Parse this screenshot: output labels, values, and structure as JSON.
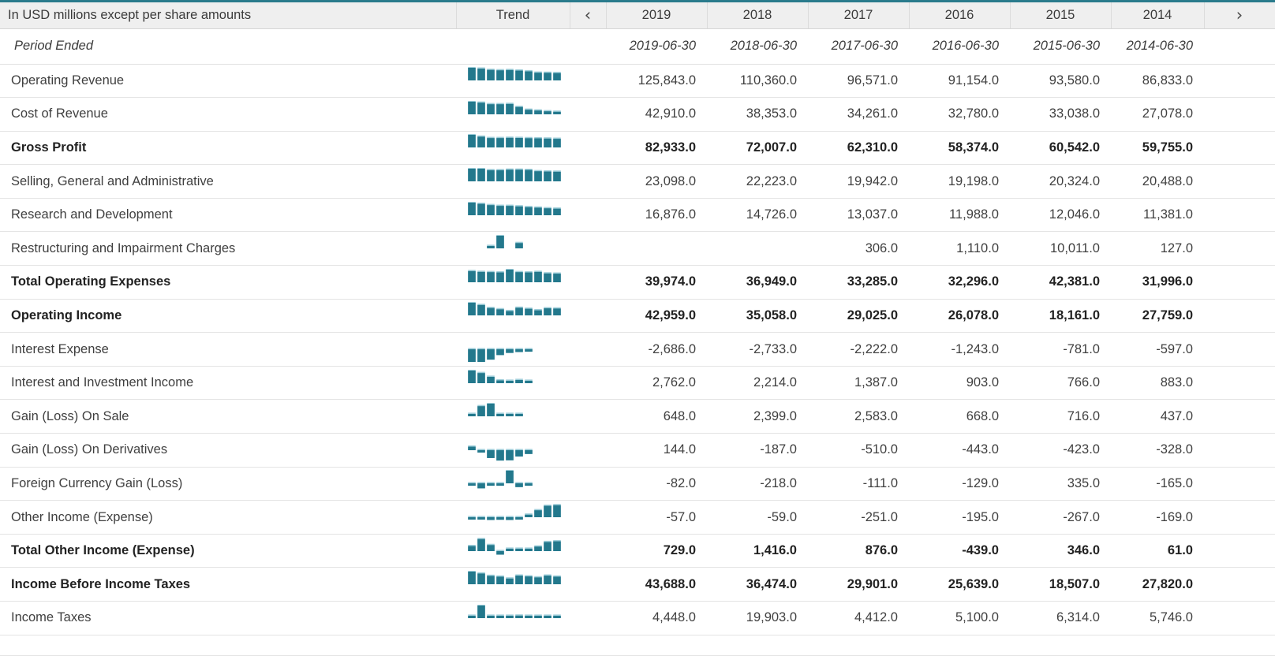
{
  "header": {
    "label_column": "In USD millions except per share amounts",
    "trend_column": "Trend",
    "prev_icon": "‹",
    "next_icon": "›",
    "years": [
      "2019",
      "2018",
      "2017",
      "2016",
      "2015",
      "2014"
    ]
  },
  "period": {
    "label": "Period Ended",
    "dates": [
      "2019-06-30",
      "2018-06-30",
      "2017-06-30",
      "2016-06-30",
      "2015-06-30",
      "2014-06-30"
    ]
  },
  "colors": {
    "accent_top_border": "#2a7b8c",
    "sparkline_bar": "#23788c",
    "sparkline_bar_light": "#9cccd8",
    "header_bg": "#efefef",
    "row_border": "#e4e4e4",
    "text": "#3f3f3f"
  },
  "chart_data": {
    "type": "table",
    "title": "Income Statement",
    "units": "In USD millions except per share amounts",
    "categories": [
      "2019",
      "2018",
      "2017",
      "2016",
      "2015",
      "2014"
    ],
    "period_ends": [
      "2019-06-30",
      "2018-06-30",
      "2017-06-30",
      "2016-06-30",
      "2015-06-30",
      "2014-06-30"
    ],
    "series": [
      {
        "name": "Operating Revenue",
        "values": [
          125843.0,
          110360.0,
          96571.0,
          91154.0,
          93580.0,
          86833.0
        ]
      },
      {
        "name": "Cost of Revenue",
        "values": [
          42910.0,
          38353.0,
          34261.0,
          32780.0,
          33038.0,
          27078.0
        ]
      },
      {
        "name": "Gross Profit",
        "values": [
          82933.0,
          72007.0,
          62310.0,
          58374.0,
          60542.0,
          59755.0
        ]
      },
      {
        "name": "Selling, General and Administrative",
        "values": [
          23098.0,
          22223.0,
          19942.0,
          19198.0,
          20324.0,
          20488.0
        ]
      },
      {
        "name": "Research and Development",
        "values": [
          16876.0,
          14726.0,
          13037.0,
          11988.0,
          12046.0,
          11381.0
        ]
      },
      {
        "name": "Restructuring and Impairment Charges",
        "values": [
          null,
          null,
          306.0,
          1110.0,
          10011.0,
          127.0
        ]
      },
      {
        "name": "Total Operating Expenses",
        "values": [
          39974.0,
          36949.0,
          33285.0,
          32296.0,
          42381.0,
          31996.0
        ]
      },
      {
        "name": "Operating Income",
        "values": [
          42959.0,
          35058.0,
          29025.0,
          26078.0,
          18161.0,
          27759.0
        ]
      },
      {
        "name": "Interest Expense",
        "values": [
          -2686.0,
          -2733.0,
          -2222.0,
          -1243.0,
          -781.0,
          -597.0
        ]
      },
      {
        "name": "Interest and Investment Income",
        "values": [
          2762.0,
          2214.0,
          1387.0,
          903.0,
          766.0,
          883.0
        ]
      },
      {
        "name": "Gain (Loss) On Sale",
        "values": [
          648.0,
          2399.0,
          2583.0,
          668.0,
          716.0,
          437.0
        ]
      },
      {
        "name": "Gain (Loss) On Derivatives",
        "values": [
          144.0,
          -187.0,
          -510.0,
          -443.0,
          -423.0,
          -328.0
        ]
      },
      {
        "name": "Foreign Currency Gain (Loss)",
        "values": [
          -82.0,
          -218.0,
          -111.0,
          -129.0,
          335.0,
          -165.0
        ]
      },
      {
        "name": "Other Income (Expense)",
        "values": [
          -57.0,
          -59.0,
          -251.0,
          -195.0,
          -267.0,
          -169.0
        ]
      },
      {
        "name": "Total Other Income (Expense)",
        "values": [
          729.0,
          1416.0,
          876.0,
          -439.0,
          346.0,
          61.0
        ]
      },
      {
        "name": "Income Before Income Taxes",
        "values": [
          43688.0,
          36474.0,
          29901.0,
          25639.0,
          18507.0,
          27820.0
        ]
      },
      {
        "name": "Income Taxes",
        "values": [
          4448.0,
          19903.0,
          4412.0,
          5100.0,
          6314.0,
          5746.0
        ]
      }
    ]
  },
  "rows": [
    {
      "label": "Operating Revenue",
      "bold": false,
      "values": [
        "125,843.0",
        "110,360.0",
        "96,571.0",
        "91,154.0",
        "93,580.0",
        "86,833.0"
      ],
      "trend": [
        1.0,
        0.93,
        0.83,
        0.8,
        0.82,
        0.78,
        0.72,
        0.61,
        0.6,
        0.58
      ]
    },
    {
      "label": "Cost of Revenue",
      "bold": false,
      "values": [
        "42,910.0",
        "38,353.0",
        "34,261.0",
        "32,780.0",
        "33,038.0",
        "27,078.0"
      ],
      "trend": [
        1.0,
        0.92,
        0.8,
        0.8,
        0.82,
        0.58,
        0.36,
        0.3,
        0.24,
        0.2
      ]
    },
    {
      "label": "Gross Profit",
      "bold": true,
      "values": [
        "82,933.0",
        "72,007.0",
        "62,310.0",
        "58,374.0",
        "60,542.0",
        "59,755.0"
      ],
      "trend": [
        1.0,
        0.85,
        0.74,
        0.74,
        0.76,
        0.75,
        0.73,
        0.72,
        0.7,
        0.68
      ]
    },
    {
      "label": "Selling, General and Administrative",
      "bold": false,
      "values": [
        "23,098.0",
        "22,223.0",
        "19,942.0",
        "19,198.0",
        "20,324.0",
        "20,488.0"
      ],
      "trend": [
        1.0,
        1.0,
        0.88,
        0.88,
        0.92,
        0.92,
        0.9,
        0.8,
        0.78,
        0.76
      ]
    },
    {
      "label": "Research and Development",
      "bold": false,
      "values": [
        "16,876.0",
        "14,726.0",
        "13,037.0",
        "11,988.0",
        "12,046.0",
        "11,381.0"
      ],
      "trend": [
        1.0,
        0.9,
        0.8,
        0.74,
        0.74,
        0.7,
        0.64,
        0.6,
        0.55,
        0.52
      ]
    },
    {
      "label": "Restructuring and Impairment Charges",
      "bold": false,
      "values": [
        "",
        "",
        "306.0",
        "1,110.0",
        "10,011.0",
        "127.0"
      ],
      "trend": [
        0,
        0,
        0.04,
        1.0,
        0,
        0.42,
        0,
        0,
        0,
        0
      ]
    },
    {
      "label": "Total Operating Expenses",
      "bold": true,
      "values": [
        "39,974.0",
        "36,949.0",
        "33,285.0",
        "32,296.0",
        "42,381.0",
        "31,996.0"
      ],
      "trend": [
        0.88,
        0.82,
        0.8,
        0.78,
        1.0,
        0.8,
        0.78,
        0.82,
        0.7,
        0.68
      ]
    },
    {
      "label": "Operating Income",
      "bold": true,
      "values": [
        "42,959.0",
        "35,058.0",
        "29,025.0",
        "26,078.0",
        "18,161.0",
        "27,759.0"
      ],
      "trend": [
        1.0,
        0.82,
        0.58,
        0.48,
        0.34,
        0.6,
        0.52,
        0.4,
        0.56,
        0.54
      ]
    },
    {
      "label": "Interest Expense",
      "bold": false,
      "values": [
        "-2,686.0",
        "-2,733.0",
        "-2,222.0",
        "-1,243.0",
        "-781.0",
        "-597.0"
      ],
      "trend": [
        -1.0,
        -1.0,
        -0.82,
        -0.46,
        -0.29,
        -0.22,
        -0.16,
        0,
        0,
        0
      ]
    },
    {
      "label": "Interest and Investment Income",
      "bold": false,
      "values": [
        "2,762.0",
        "2,214.0",
        "1,387.0",
        "903.0",
        "766.0",
        "883.0"
      ],
      "trend": [
        1.0,
        0.8,
        0.5,
        0.22,
        0.18,
        0.25,
        0.12,
        0,
        0,
        0
      ]
    },
    {
      "label": "Gain (Loss) On Sale",
      "bold": false,
      "values": [
        "648.0",
        "2,399.0",
        "2,583.0",
        "668.0",
        "716.0",
        "437.0"
      ],
      "trend": [
        0.14,
        0.8,
        1.0,
        0.16,
        0.17,
        0.1,
        0,
        0,
        0,
        0
      ]
    },
    {
      "label": "Gain (Loss) On Derivatives",
      "bold": false,
      "values": [
        "144.0",
        "-187.0",
        "-510.0",
        "-443.0",
        "-423.0",
        "-328.0"
      ],
      "trend": [
        0.28,
        -0.18,
        -0.62,
        -0.82,
        -0.8,
        -0.5,
        -0.3,
        0,
        0,
        0
      ]
    },
    {
      "label": "Foreign Currency Gain (Loss)",
      "bold": false,
      "values": [
        "-82.0",
        "-218.0",
        "-111.0",
        "-129.0",
        "335.0",
        "-165.0"
      ],
      "trend": [
        -0.1,
        -0.4,
        -0.12,
        -0.15,
        1.0,
        -0.3,
        -0.12,
        0,
        0,
        0
      ]
    },
    {
      "label": "Other Income (Expense)",
      "bold": false,
      "values": [
        "-57.0",
        "-59.0",
        "-251.0",
        "-195.0",
        "-267.0",
        "-169.0"
      ],
      "trend": [
        -0.06,
        -0.08,
        -0.22,
        -0.2,
        -0.22,
        -0.12,
        0.2,
        0.55,
        0.9,
        0.95
      ]
    },
    {
      "label": "Total Other Income (Expense)",
      "bold": true,
      "values": [
        "729.0",
        "1,416.0",
        "876.0",
        "-439.0",
        "346.0",
        "61.0"
      ],
      "trend": [
        0.4,
        0.95,
        0.48,
        -0.28,
        0.14,
        0.04,
        0.12,
        0.36,
        0.72,
        0.78
      ]
    },
    {
      "label": "Income Before Income Taxes",
      "bold": true,
      "values": [
        "43,688.0",
        "36,474.0",
        "29,901.0",
        "25,639.0",
        "18,507.0",
        "27,820.0"
      ],
      "trend": [
        1.0,
        0.85,
        0.66,
        0.6,
        0.45,
        0.68,
        0.62,
        0.54,
        0.68,
        0.6
      ]
    },
    {
      "label": "Income Taxes",
      "bold": false,
      "values": [
        "4,448.0",
        "19,903.0",
        "4,412.0",
        "5,100.0",
        "6,314.0",
        "5,746.0"
      ],
      "trend": [
        0.14,
        1.0,
        0.14,
        0.16,
        0.18,
        0.2,
        0.15,
        0.14,
        0.13,
        0.16
      ]
    }
  ]
}
